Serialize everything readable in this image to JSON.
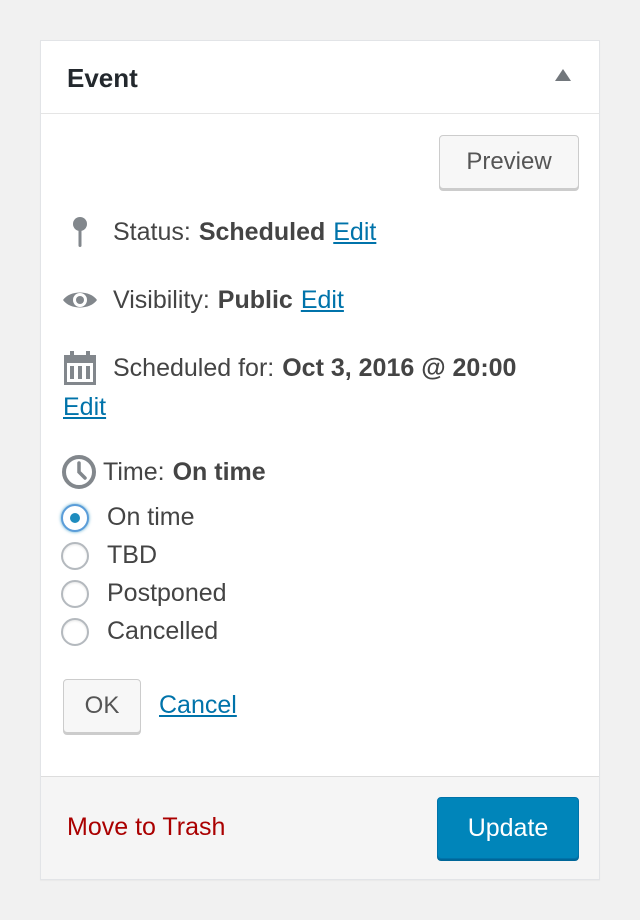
{
  "panel": {
    "title": "Event"
  },
  "preview": {
    "label": "Preview"
  },
  "status": {
    "label": "Status:",
    "value": "Scheduled",
    "edit": "Edit"
  },
  "visibility": {
    "label": "Visibility:",
    "value": "Public",
    "edit": "Edit"
  },
  "scheduled": {
    "label": "Scheduled for:",
    "value": "Oct 3, 2016 @ 20:00",
    "edit": "Edit"
  },
  "time": {
    "label": "Time:",
    "value": "On time",
    "options": [
      "On time",
      "TBD",
      "Postponed",
      "Cancelled"
    ],
    "selected": "On time"
  },
  "actions": {
    "ok": "OK",
    "cancel": "Cancel"
  },
  "footer": {
    "trash": "Move to Trash",
    "update": "Update"
  },
  "colors": {
    "accent": "#0085ba",
    "link": "#0073aa",
    "danger": "#a00"
  },
  "icons": [
    "collapse-arrow-icon",
    "pin-icon",
    "eye-icon",
    "calendar-icon",
    "clock-icon"
  ]
}
